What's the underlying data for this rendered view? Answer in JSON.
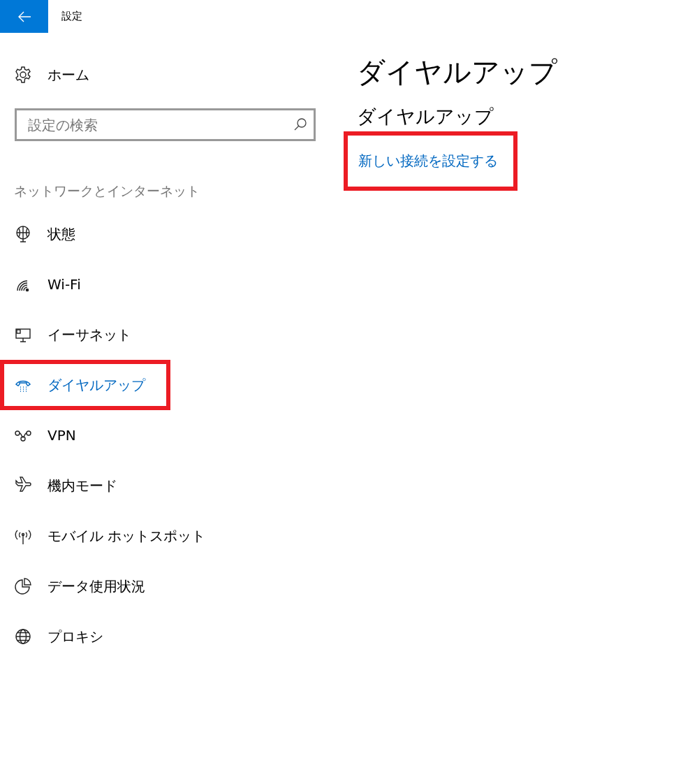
{
  "window": {
    "title": "設定"
  },
  "sidebar": {
    "home": "ホーム",
    "search": {
      "placeholder": "設定の検索"
    },
    "section": "ネットワークとインターネット",
    "items": [
      {
        "label": "状態",
        "selected": false,
        "highlighted": false
      },
      {
        "label": "Wi-Fi",
        "selected": false,
        "highlighted": false
      },
      {
        "label": "イーサネット",
        "selected": false,
        "highlighted": false
      },
      {
        "label": "ダイヤルアップ",
        "selected": true,
        "highlighted": true
      },
      {
        "label": "VPN",
        "selected": false,
        "highlighted": false
      },
      {
        "label": "機内モード",
        "selected": false,
        "highlighted": false
      },
      {
        "label": "モバイル ホットスポット",
        "selected": false,
        "highlighted": false
      },
      {
        "label": "データ使用状況",
        "selected": false,
        "highlighted": false
      },
      {
        "label": "プロキシ",
        "selected": false,
        "highlighted": false
      }
    ]
  },
  "content": {
    "title": "ダイヤルアップ",
    "section": "ダイヤルアップ",
    "link": {
      "label": "新しい接続を設定する",
      "highlighted": true
    }
  }
}
